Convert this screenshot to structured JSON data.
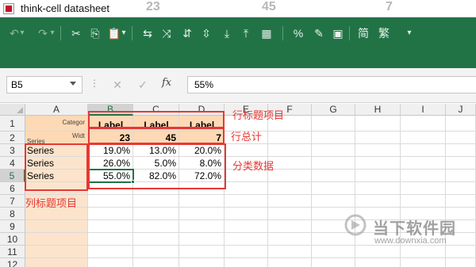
{
  "window": {
    "title": "think-cell datasheet",
    "ghost_values": [
      "23",
      "45",
      "7"
    ]
  },
  "ribbon": {
    "buttons": [
      {
        "name": "undo-button",
        "glyph": "↶",
        "dim": true
      },
      {
        "name": "undo-dropdown",
        "glyph": "▾",
        "dim": true
      },
      {
        "name": "redo-button",
        "glyph": "↷",
        "dim": true
      },
      {
        "name": "redo-dropdown",
        "glyph": "▾",
        "dim": true
      },
      {
        "name": "cut-button",
        "glyph": "✂"
      },
      {
        "name": "copy-button",
        "glyph": "⎘"
      },
      {
        "name": "paste-button",
        "glyph": "📋"
      },
      {
        "name": "paste-dropdown",
        "glyph": "▾"
      },
      {
        "name": "transpose-button",
        "glyph": "⇆"
      },
      {
        "name": "insert-cut-cells-button",
        "glyph": "⤨"
      },
      {
        "name": "insert-column-button",
        "glyph": "⇵"
      },
      {
        "name": "delete-column-button",
        "glyph": "⇳"
      },
      {
        "name": "insert-row-button",
        "glyph": "⤓"
      },
      {
        "name": "delete-row-button",
        "glyph": "⤒"
      },
      {
        "name": "chart-data-button",
        "glyph": "▦"
      },
      {
        "name": "percent-button",
        "glyph": "%"
      },
      {
        "name": "format-painter-button",
        "glyph": "✎"
      },
      {
        "name": "form-button",
        "glyph": "▣"
      },
      {
        "name": "simplified-chinese-button",
        "glyph": "简"
      },
      {
        "name": "traditional-chinese-button",
        "glyph": "繁"
      },
      {
        "name": "more-dropdown",
        "glyph": "▾"
      }
    ]
  },
  "formula_bar": {
    "name_box": "B5",
    "cancel_glyph": "✕",
    "enter_glyph": "✓",
    "fx_label": "fx",
    "value": "55%"
  },
  "grid": {
    "columns": [
      "A",
      "B",
      "C",
      "D",
      "E",
      "F",
      "G",
      "H",
      "I",
      "J"
    ],
    "rows": [
      "1",
      "2",
      "3",
      "4",
      "5",
      "6",
      "7",
      "8",
      "9",
      "10",
      "11",
      "12"
    ],
    "cells": {
      "a1": "Categor",
      "a2": "Widt",
      "a2_sub": "Series",
      "labels": [
        "Label",
        "Label",
        "Label"
      ],
      "totals": [
        "23",
        "45",
        "7"
      ],
      "data_rows": [
        {
          "series": "Series",
          "values": [
            "19.0%",
            "13.0%",
            "20.0%"
          ]
        },
        {
          "series": "Series",
          "values": [
            "26.0%",
            "5.0%",
            "8.0%"
          ]
        },
        {
          "series": "Series",
          "values": [
            "55.0%",
            "82.0%",
            "72.0%"
          ]
        }
      ]
    }
  },
  "annotations": {
    "row_title_items": "行标题项目",
    "row_total": "行总计",
    "category_data": "分类数据",
    "column_title_items": "列标题项目"
  },
  "watermark": {
    "text": "当下软件园",
    "url": "www.downxia.com"
  }
}
